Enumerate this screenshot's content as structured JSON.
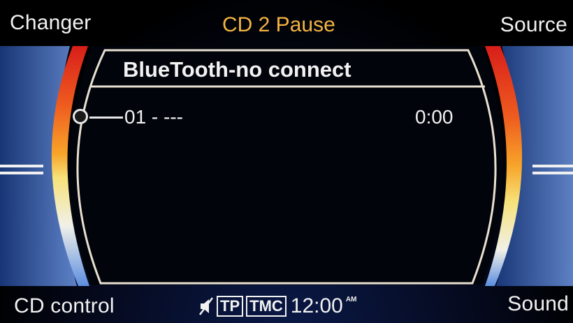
{
  "header": {
    "left_label": "Changer",
    "center_status": "CD 2 Pause",
    "right_label": "Source"
  },
  "main": {
    "title": "BlueTooth-no connect",
    "track": {
      "name": "01 - ---",
      "time": "0:00"
    }
  },
  "footer": {
    "left_label": "CD control",
    "right_label": "Sound",
    "tp_badge": "TP",
    "tmc_badge": "TMC",
    "clock": "12:00",
    "ampm": "AM"
  },
  "icons": {
    "mute": "speaker-mute-icon"
  },
  "colors": {
    "status_accent": "#f4b342",
    "frame": "#e8e0d0",
    "arc_red": "#e2251b",
    "arc_orange": "#f39a24",
    "arc_yellow": "#f7e27a",
    "arc_blue": "#4a7fd8"
  }
}
